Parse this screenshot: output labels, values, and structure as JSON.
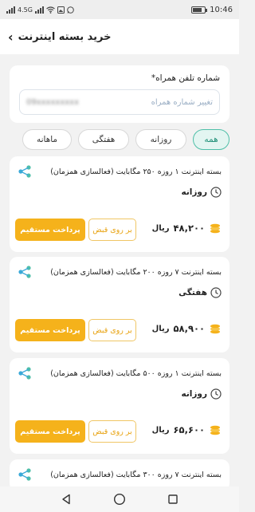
{
  "status_bar": {
    "network": "4.5G",
    "time": "10:46",
    "battery_level": 0.8
  },
  "header": {
    "title": "خرید بسته اینترنت",
    "back_icon": "chevron-left-icon"
  },
  "phone": {
    "label": "شماره تلفن همراه*",
    "value": "09xxxxxxxxx",
    "change_link": "تغییر شماره همراه"
  },
  "tabs": [
    {
      "label": "همه",
      "active": true
    },
    {
      "label": "روزانه",
      "active": false
    },
    {
      "label": "هفتگی",
      "active": false
    },
    {
      "label": "ماهانه",
      "active": false
    }
  ],
  "packages": [
    {
      "title": "بسته اینترنت ۱ روزه ۲۵۰ مگابایت (فعالسازی همزمان)",
      "period": "روزانه",
      "price": "۴۸,۲۰۰",
      "unit": "ریال",
      "bill_label": "بر روی قبض",
      "pay_label": "پرداخت مستقیم"
    },
    {
      "title": "بسته اینترنت ۷ روزه ۲۰۰ مگابایت (فعالسازی همزمان)",
      "period": "هفتگی",
      "price": "۵۸,۹۰۰",
      "unit": "ریال",
      "bill_label": "بر روی قبض",
      "pay_label": "پرداخت مستقیم"
    },
    {
      "title": "بسته اینترنت ۱ روزه ۵۰۰ مگابایت (فعالسازی همزمان)",
      "period": "روزانه",
      "price": "۶۵,۶۰۰",
      "unit": "ریال",
      "bill_label": "بر روی قبض",
      "pay_label": "پرداخت مستقیم"
    },
    {
      "title": "بسته اینترنت ۷ روزه ۳۰۰ مگابایت (فعالسازی همزمان)"
    }
  ],
  "colors": {
    "accent_green": "#4fbfa8",
    "accent_yellow": "#f5b21b",
    "background": "#f2f2f2"
  }
}
